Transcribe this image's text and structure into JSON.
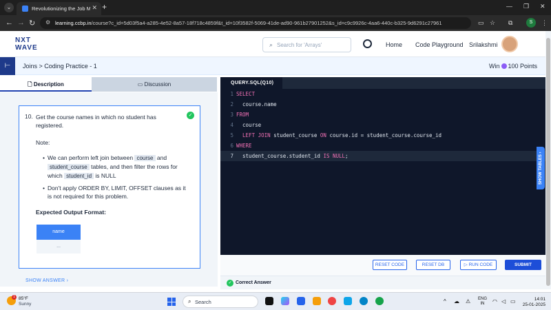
{
  "browser": {
    "tab_title": "Revolutionizing the Job Market",
    "url_host": "learning.ccbp.in",
    "url_path": "/course?c_id=5d03f5a4-a285-4e52-8a57-18f718c4859f&t_id=10f3582f-5069-41de-ad90-961b27901252&s_id=c9c9926c-4aa6-440c-b325-9d6291c27961",
    "profile_initial": "S"
  },
  "header": {
    "logo_line1": "NXT",
    "logo_line2": "WAVE",
    "search_placeholder": "Search for 'Arrays'",
    "nav": [
      "Home",
      "Code Playground"
    ],
    "username": "Srilakshmi"
  },
  "subheader": {
    "breadcrumb": "Joins > Coding Practice - 1",
    "win_label": "Win",
    "points": "100 Points"
  },
  "left_panel": {
    "tabs": [
      "Description",
      "Discussion"
    ],
    "question_number": "10.",
    "question_text": "Get the course names in which no student has registered.",
    "note_title": "Note:",
    "bullet1": {
      "pre": "We can perform left join between",
      "chip1": "course",
      "mid": "and",
      "chip2": "student_course",
      "post": "tables, and then filter the rows for which",
      "chip3": "student_id",
      "end": "is NULL"
    },
    "bullet2": "Don't apply ORDER BY, LIMIT, OFFSET clauses as it is not required for this problem.",
    "expected_title": "Expected Output Format:",
    "output_header": "name",
    "output_cell": "...",
    "show_answer": "SHOW ANSWER"
  },
  "editor": {
    "tab": "QUERY.SQL(Q10)",
    "line_numbers": [
      "1",
      "2",
      "3",
      "4",
      "5",
      "6",
      "7"
    ],
    "l1": "SELECT",
    "l2": "  course.name",
    "l3": "FROM",
    "l4": "  course",
    "l5_kw1": "LEFT JOIN",
    "l5_a": " student_course ",
    "l5_kw2": "ON",
    "l5_b": " course.id = student_course.course_id",
    "l6": "WHERE",
    "l7_a": "  student_course.student_id ",
    "l7_kw": "IS NULL",
    "l7_b": ";",
    "show_tables": "SHOW TABLES",
    "buttons": {
      "reset_code": "RESET CODE",
      "reset_db": "RESET DB",
      "run_code": "RUN CODE",
      "submit": "SUBMIT"
    },
    "result": "Correct Answer"
  },
  "taskbar": {
    "temperature": "85°F",
    "condition": "Sunny",
    "weather_badge": "1",
    "search_label": "Search",
    "lang1": "ENG",
    "lang2": "IN",
    "time": "14:01",
    "date": "25-01-2025"
  },
  "colors": {
    "brand_blue": "#1e3a8a",
    "accent_blue": "#3b82f6",
    "editor_bg": "#0f172a",
    "keyword_pink": "#f472b6",
    "success_green": "#22c55e"
  }
}
